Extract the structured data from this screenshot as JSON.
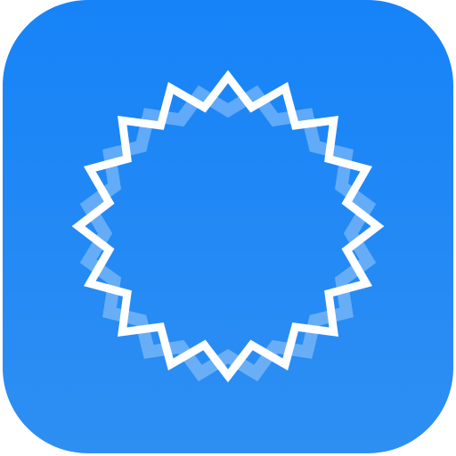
{
  "app_icon": {
    "icon": "starburst-badge-icon",
    "colors": {
      "gradient_top": "#1683f8",
      "gradient_bottom": "#2e8ff2",
      "outline_primary": "#ffffff",
      "outline_secondary": "#ffffff"
    },
    "starburst": {
      "points": 16,
      "secondary_opacity": 0.3
    }
  }
}
